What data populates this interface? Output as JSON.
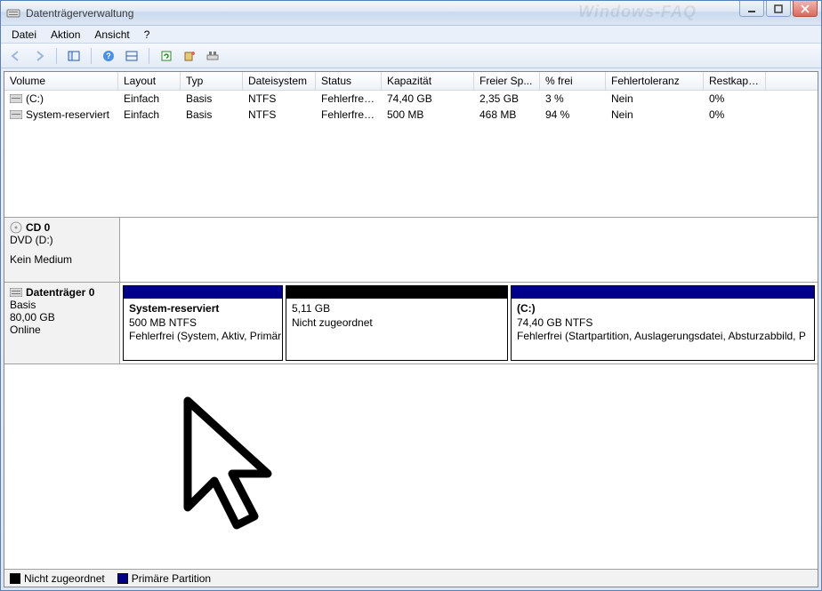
{
  "window": {
    "title": "Datenträgerverwaltung",
    "watermark": "Windows-FAQ"
  },
  "menu": {
    "file": "Datei",
    "action": "Aktion",
    "view": "Ansicht",
    "help": "?"
  },
  "toolbar_icons": {
    "back": "back-arrow-icon",
    "forward": "forward-arrow-icon",
    "up": "up-pane-icon",
    "help": "help-icon",
    "props": "properties-icon",
    "refresh": "refresh-icon",
    "list1": "action-icon",
    "list2": "settings-icon"
  },
  "columns": {
    "volume": "Volume",
    "layout": "Layout",
    "type": "Typ",
    "fs": "Dateisystem",
    "status": "Status",
    "capacity": "Kapazität",
    "free": "Freier Sp...",
    "pct": "% frei",
    "fault": "Fehlertoleranz",
    "rest": "Restkapazi..."
  },
  "volumes": [
    {
      "name": "(C:)",
      "layout": "Einfach",
      "type": "Basis",
      "fs": "NTFS",
      "status": "Fehlerfrei (...",
      "capacity": "74,40 GB",
      "free": "2,35 GB",
      "pct": "3 %",
      "fault": "Nein",
      "rest": "0%"
    },
    {
      "name": "System-reserviert",
      "layout": "Einfach",
      "type": "Basis",
      "fs": "NTFS",
      "status": "Fehlerfrei (...",
      "capacity": "500 MB",
      "free": "468 MB",
      "pct": "94 %",
      "fault": "Nein",
      "rest": "0%"
    }
  ],
  "disks": {
    "cd": {
      "name": "CD 0",
      "drive": "DVD (D:)",
      "status": "Kein Medium"
    },
    "disk0": {
      "name": "Datenträger 0",
      "type": "Basis",
      "size": "80,00 GB",
      "status": "Online",
      "partitions": [
        {
          "kind": "primary",
          "title": "System-reserviert",
          "line2": "500 MB NTFS",
          "line3": "Fehlerfrei (System, Aktiv, Primär",
          "flex": "0 0 180px"
        },
        {
          "kind": "unallocated",
          "title": "",
          "line2": "5,11 GB",
          "line3": "Nicht zugeordnet",
          "flex": "0 0 250px"
        },
        {
          "kind": "primary",
          "title": "(C:)",
          "line2": "74,40 GB NTFS",
          "line3": "Fehlerfrei (Startpartition, Auslagerungsdatei, Absturzabbild, P",
          "flex": "1 1 auto"
        }
      ]
    }
  },
  "legend": {
    "unallocated": "Nicht zugeordnet",
    "primary": "Primäre Partition"
  }
}
